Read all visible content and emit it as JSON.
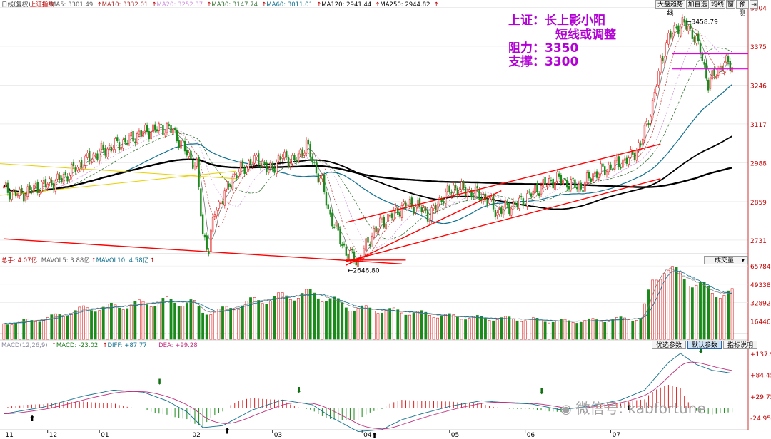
{
  "top_buttons": [
    "大盘趋势线",
    "加自选",
    "均线",
    "窗",
    "预测"
  ],
  "main_legend": [
    {
      "label": "日线(复权)",
      "color": "#404040"
    },
    {
      "label": "上证指数",
      "color": "#c00000"
    },
    {
      "label": "MA5: 3301.49",
      "color": "#606060"
    },
    {
      "label": "MA10: 3332.01",
      "color": "#b03030"
    },
    {
      "label": "MA20: 3252.37",
      "color": "#d090e0"
    },
    {
      "label": "MA30: 3147.74",
      "color": "#307030"
    },
    {
      "label": "MA60: 3011.01",
      "color": "#107090"
    },
    {
      "label": "MA120: 2941.44",
      "color": "#000000"
    },
    {
      "label": "MA250: 2944.82",
      "color": "#000000"
    }
  ],
  "vol_legend": [
    {
      "label": "总手: 4.07亿",
      "color": "#c00000"
    },
    {
      "label": "MAVOL5: 3.88亿",
      "color": "#606060"
    },
    {
      "label": "MAVOL10: 4.58亿",
      "color": "#107090"
    }
  ],
  "vol_dropdown": "成交量",
  "macd_legend": [
    {
      "label": "MACD(12,26,9)",
      "color": "#8a8aa0"
    },
    {
      "label": "MACD: -23.02",
      "color": "#208020"
    },
    {
      "label": "DIFF: +87.77",
      "color": "#107090"
    },
    {
      "label": "DEA: +99.28",
      "color": "#c03080"
    }
  ],
  "macd_buttons": [
    "优选参数",
    "默认参数",
    "指标说明"
  ],
  "annotation_lines": [
    "上证：长上影小阳",
    "短线或调整",
    "阻力：3350",
    "支撑：3300"
  ],
  "watermark": "微信号: kabfortune",
  "colors": {
    "up": "#e02020",
    "down": "#1a8a1a",
    "trend": "#ff0000",
    "axis": "#c00000",
    "annot": "#b300d6"
  },
  "chart_data": {
    "type": "candlestick",
    "x_labels": [
      "11",
      "12",
      "01",
      "02",
      "03",
      "04",
      "05",
      "06",
      "07"
    ],
    "price_axis": [
      3504,
      3375,
      3246,
      3117,
      2988,
      2859,
      2731
    ],
    "price_ylim": [
      2700,
      3510
    ],
    "price_labels": {
      "high": "3458.79",
      "low": "2646.80"
    },
    "volume_axis": [
      65784,
      49338,
      32892,
      16446
    ],
    "macd_axis": [
      "+137.9",
      "+84.45",
      "+29.75",
      "-24.95"
    ],
    "ma_summary": {
      "MA5": 3301.49,
      "MA10": 3332.01,
      "MA20": 3252.37,
      "MA30": 3147.74,
      "MA60": 3011.01,
      "MA120": 2941.44,
      "MA250": 2944.82
    },
    "close_anchors": [
      [
        0,
        2900
      ],
      [
        8,
        2880
      ],
      [
        16,
        2905
      ],
      [
        28,
        2930
      ],
      [
        40,
        2990
      ],
      [
        50,
        3030
      ],
      [
        60,
        3055
      ],
      [
        70,
        3090
      ],
      [
        80,
        3105
      ],
      [
        85,
        3095
      ],
      [
        92,
        3020
      ],
      [
        97,
        2975
      ],
      [
        100,
        2750
      ],
      [
        103,
        2700
      ],
      [
        106,
        2830
      ],
      [
        110,
        2870
      ],
      [
        115,
        2940
      ],
      [
        122,
        2980
      ],
      [
        128,
        3000
      ],
      [
        133,
        2960
      ],
      [
        140,
        3010
      ],
      [
        146,
        2990
      ],
      [
        152,
        3050
      ],
      [
        157,
        2960
      ],
      [
        160,
        2920
      ],
      [
        163,
        2830
      ],
      [
        168,
        2750
      ],
      [
        172,
        2690
      ],
      [
        178,
        2660
      ],
      [
        182,
        2710
      ],
      [
        186,
        2760
      ],
      [
        190,
        2790
      ],
      [
        196,
        2820
      ],
      [
        202,
        2850
      ],
      [
        208,
        2845
      ],
      [
        214,
        2810
      ],
      [
        220,
        2870
      ],
      [
        226,
        2905
      ],
      [
        232,
        2895
      ],
      [
        238,
        2885
      ],
      [
        244,
        2860
      ],
      [
        248,
        2820
      ],
      [
        252,
        2840
      ],
      [
        258,
        2850
      ],
      [
        264,
        2880
      ],
      [
        270,
        2910
      ],
      [
        278,
        2935
      ],
      [
        284,
        2920
      ],
      [
        290,
        2905
      ],
      [
        296,
        2950
      ],
      [
        302,
        2965
      ],
      [
        308,
        2985
      ],
      [
        314,
        3000
      ],
      [
        320,
        3050
      ],
      [
        326,
        3180
      ],
      [
        330,
        3320
      ],
      [
        334,
        3400
      ],
      [
        338,
        3440
      ],
      [
        342,
        3450
      ],
      [
        346,
        3420
      ],
      [
        350,
        3360
      ],
      [
        354,
        3250
      ],
      [
        358,
        3290
      ],
      [
        362,
        3320
      ],
      [
        366,
        3310
      ]
    ],
    "volume_anchors": [
      [
        0,
        14000
      ],
      [
        20,
        18000
      ],
      [
        40,
        27000
      ],
      [
        60,
        30000
      ],
      [
        80,
        34000
      ],
      [
        95,
        33000
      ],
      [
        100,
        24000
      ],
      [
        110,
        26000
      ],
      [
        125,
        34000
      ],
      [
        140,
        38000
      ],
      [
        155,
        41000
      ],
      [
        165,
        35000
      ],
      [
        175,
        28000
      ],
      [
        190,
        26000
      ],
      [
        205,
        24000
      ],
      [
        220,
        21000
      ],
      [
        240,
        19000
      ],
      [
        260,
        18000
      ],
      [
        280,
        16000
      ],
      [
        300,
        17000
      ],
      [
        320,
        19000
      ],
      [
        326,
        50000
      ],
      [
        332,
        65784
      ],
      [
        338,
        58000
      ],
      [
        346,
        52000
      ],
      [
        356,
        42000
      ],
      [
        366,
        40700
      ]
    ],
    "macd_anchors": [
      [
        0,
        -15
      ],
      [
        20,
        2
      ],
      [
        40,
        30
      ],
      [
        55,
        45
      ],
      [
        70,
        40
      ],
      [
        82,
        18
      ],
      [
        92,
        -10
      ],
      [
        100,
        -50
      ],
      [
        110,
        -45
      ],
      [
        125,
        -5
      ],
      [
        140,
        20
      ],
      [
        155,
        8
      ],
      [
        165,
        -25
      ],
      [
        178,
        -60
      ],
      [
        190,
        -55
      ],
      [
        200,
        -30
      ],
      [
        210,
        -15
      ],
      [
        225,
        5
      ],
      [
        240,
        18
      ],
      [
        255,
        12
      ],
      [
        265,
        10
      ],
      [
        280,
        -5
      ],
      [
        295,
        5
      ],
      [
        310,
        20
      ],
      [
        322,
        45
      ],
      [
        328,
        80
      ],
      [
        334,
        115
      ],
      [
        340,
        137.9
      ],
      [
        348,
        110
      ],
      [
        356,
        95
      ],
      [
        366,
        87.77
      ]
    ],
    "trendlines": [
      {
        "from": [
          0,
          2735
        ],
        "to": [
          200,
          2652
        ]
      },
      {
        "from": [
          172,
          2660
        ],
        "to": [
          330,
          2935
        ]
      },
      {
        "from": [
          172,
          2790
        ],
        "to": [
          330,
          3050
        ]
      },
      {
        "from": [
          172,
          2648
        ],
        "to": [
          250,
          2895
        ]
      },
      {
        "from": [
          172,
          2665
        ],
        "to": [
          202,
          2665
        ]
      }
    ],
    "levels": [
      3350,
      3300
    ]
  }
}
